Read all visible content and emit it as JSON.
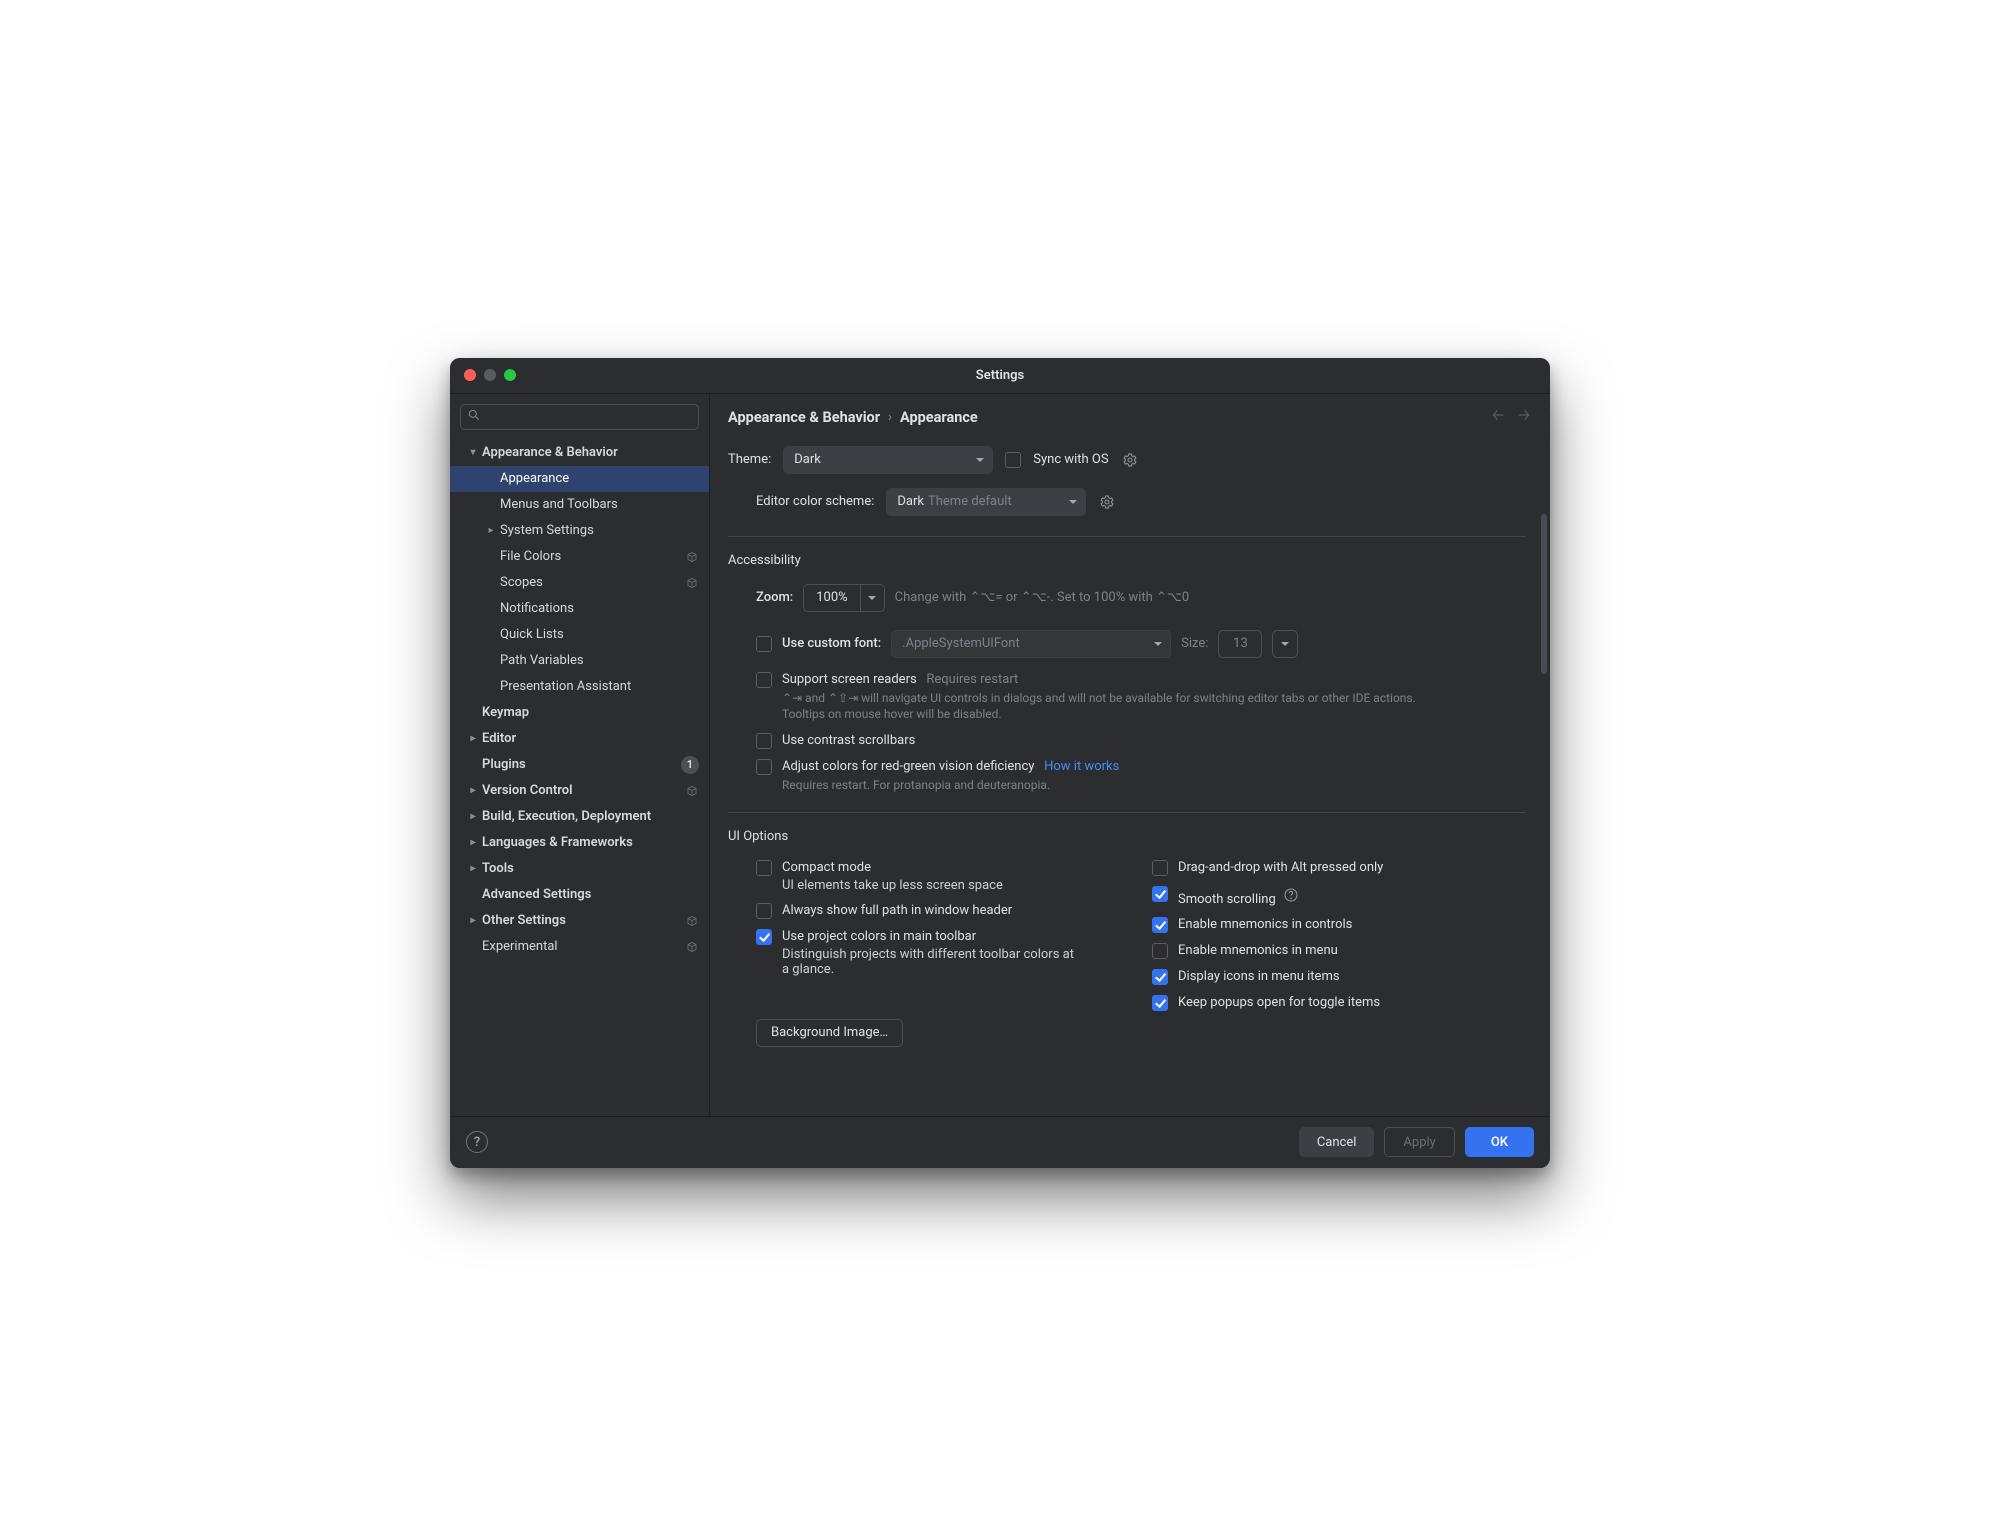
{
  "window": {
    "title": "Settings"
  },
  "search": {
    "placeholder": ""
  },
  "sidebar": [
    {
      "label": "Appearance & Behavior",
      "level": 0,
      "caret": "down",
      "bold": true
    },
    {
      "label": "Appearance",
      "level": 1,
      "active": true
    },
    {
      "label": "Menus and Toolbars",
      "level": 1
    },
    {
      "label": "System Settings",
      "level": 1,
      "caret": "right"
    },
    {
      "label": "File Colors",
      "level": 1,
      "kube": true
    },
    {
      "label": "Scopes",
      "level": 1,
      "kube": true
    },
    {
      "label": "Notifications",
      "level": 1
    },
    {
      "label": "Quick Lists",
      "level": 1
    },
    {
      "label": "Path Variables",
      "level": 1
    },
    {
      "label": "Presentation Assistant",
      "level": 1
    },
    {
      "label": "Keymap",
      "level": 0,
      "bold": true
    },
    {
      "label": "Editor",
      "level": 0,
      "caret": "right",
      "bold": true
    },
    {
      "label": "Plugins",
      "level": 0,
      "bold": true,
      "badge": "1"
    },
    {
      "label": "Version Control",
      "level": 0,
      "caret": "right",
      "bold": true,
      "kube": true
    },
    {
      "label": "Build, Execution, Deployment",
      "level": 0,
      "caret": "right",
      "bold": true
    },
    {
      "label": "Languages & Frameworks",
      "level": 0,
      "caret": "right",
      "bold": true
    },
    {
      "label": "Tools",
      "level": 0,
      "caret": "right",
      "bold": true
    },
    {
      "label": "Advanced Settings",
      "level": 0,
      "bold": true
    },
    {
      "label": "Other Settings",
      "level": 0,
      "caret": "right",
      "bold": true,
      "kube": true
    },
    {
      "label": "Experimental",
      "level": 0,
      "kube": true
    }
  ],
  "breadcrumb": {
    "root": "Appearance & Behavior",
    "leaf": "Appearance"
  },
  "theme": {
    "label": "Theme:",
    "value": "Dark",
    "sync_label": "Sync with OS"
  },
  "editor_scheme": {
    "label": "Editor color scheme:",
    "value": "Dark",
    "suffix": "Theme default"
  },
  "sections": {
    "accessibility": "Accessibility",
    "ui_options": "UI Options"
  },
  "zoom": {
    "label": "Zoom:",
    "value": "100%",
    "hint": "Change with ⌃⌥= or ⌃⌥-. Set to 100% with ⌃⌥0"
  },
  "custom_font": {
    "label": "Use custom font:",
    "font_value": ".AppleSystemUIFont",
    "size_label": "Size:",
    "size_value": "13"
  },
  "options": {
    "screen_readers": {
      "label": "Support screen readers",
      "badge": "Requires restart",
      "desc": "⌃⇥ and ⌃⇧⇥ will navigate UI controls in dialogs and will not be available for switching editor tabs or other IDE actions. Tooltips on mouse hover will be disabled."
    },
    "contrast_scroll": {
      "label": "Use contrast scrollbars"
    },
    "color_deficiency": {
      "label": "Adjust colors for red-green vision deficiency",
      "link": "How it works",
      "desc": "Requires restart. For protanopia and deuteranopia."
    }
  },
  "ui_opts_left": [
    {
      "label": "Compact mode",
      "desc": "UI elements take up less screen space",
      "checked": false
    },
    {
      "label": "Always show full path in window header",
      "checked": false
    },
    {
      "label": "Use project colors in main toolbar",
      "desc": "Distinguish projects with different toolbar colors at a glance.",
      "checked": true
    }
  ],
  "ui_opts_right": [
    {
      "label": "Drag-and-drop with Alt pressed only",
      "checked": false
    },
    {
      "label": "Smooth scrolling",
      "checked": true,
      "help": true
    },
    {
      "label": "Enable mnemonics in controls",
      "checked": true
    },
    {
      "label": "Enable mnemonics in menu",
      "checked": false
    },
    {
      "label": "Display icons in menu items",
      "checked": true
    },
    {
      "label": "Keep popups open for toggle items",
      "checked": true
    }
  ],
  "bg_image_btn": "Background Image…",
  "buttons": {
    "cancel": "Cancel",
    "apply": "Apply",
    "ok": "OK"
  }
}
